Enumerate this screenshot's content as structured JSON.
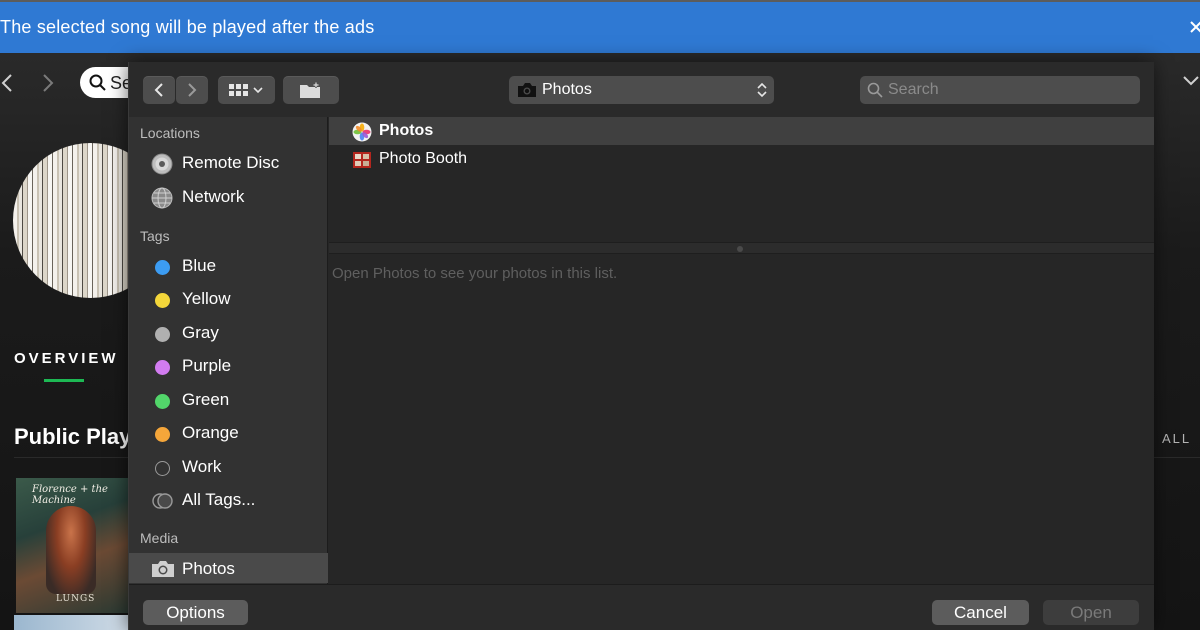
{
  "banner": {
    "text": "The selected song will be played after the ads"
  },
  "spotify": {
    "search_text": "Se",
    "overview_tab": "OVERVIEW",
    "section_title": "Public Play",
    "see_all": "ALL",
    "album_title": "Florence + the Machine",
    "album_name": "LUNGS",
    "accent": "#1db954"
  },
  "dialog": {
    "location": "Photos",
    "search_placeholder": "Search",
    "sidebar": {
      "locations_header": "Locations",
      "locations": [
        {
          "label": "Remote Disc",
          "icon": "disc-icon"
        },
        {
          "label": "Network",
          "icon": "globe-icon"
        }
      ],
      "tags_header": "Tags",
      "tags": [
        {
          "label": "Blue",
          "color": "#3c9cf2"
        },
        {
          "label": "Yellow",
          "color": "#f3d63a"
        },
        {
          "label": "Gray",
          "color": "#b0b0b0"
        },
        {
          "label": "Purple",
          "color": "#d27cf0"
        },
        {
          "label": "Green",
          "color": "#52d66a"
        },
        {
          "label": "Orange",
          "color": "#f5a63a"
        },
        {
          "label": "Work",
          "color": "none"
        },
        {
          "label": "All Tags...",
          "color": "multi"
        }
      ],
      "media_header": "Media",
      "media": [
        {
          "label": "Photos",
          "icon": "camera-icon"
        }
      ]
    },
    "files": [
      {
        "label": "Photos",
        "icon": "photos-app-icon"
      },
      {
        "label": "Photo Booth",
        "icon": "photo-booth-icon"
      }
    ],
    "hint": "Open Photos to see your photos in this list.",
    "buttons": {
      "options": "Options",
      "cancel": "Cancel",
      "open": "Open"
    }
  }
}
